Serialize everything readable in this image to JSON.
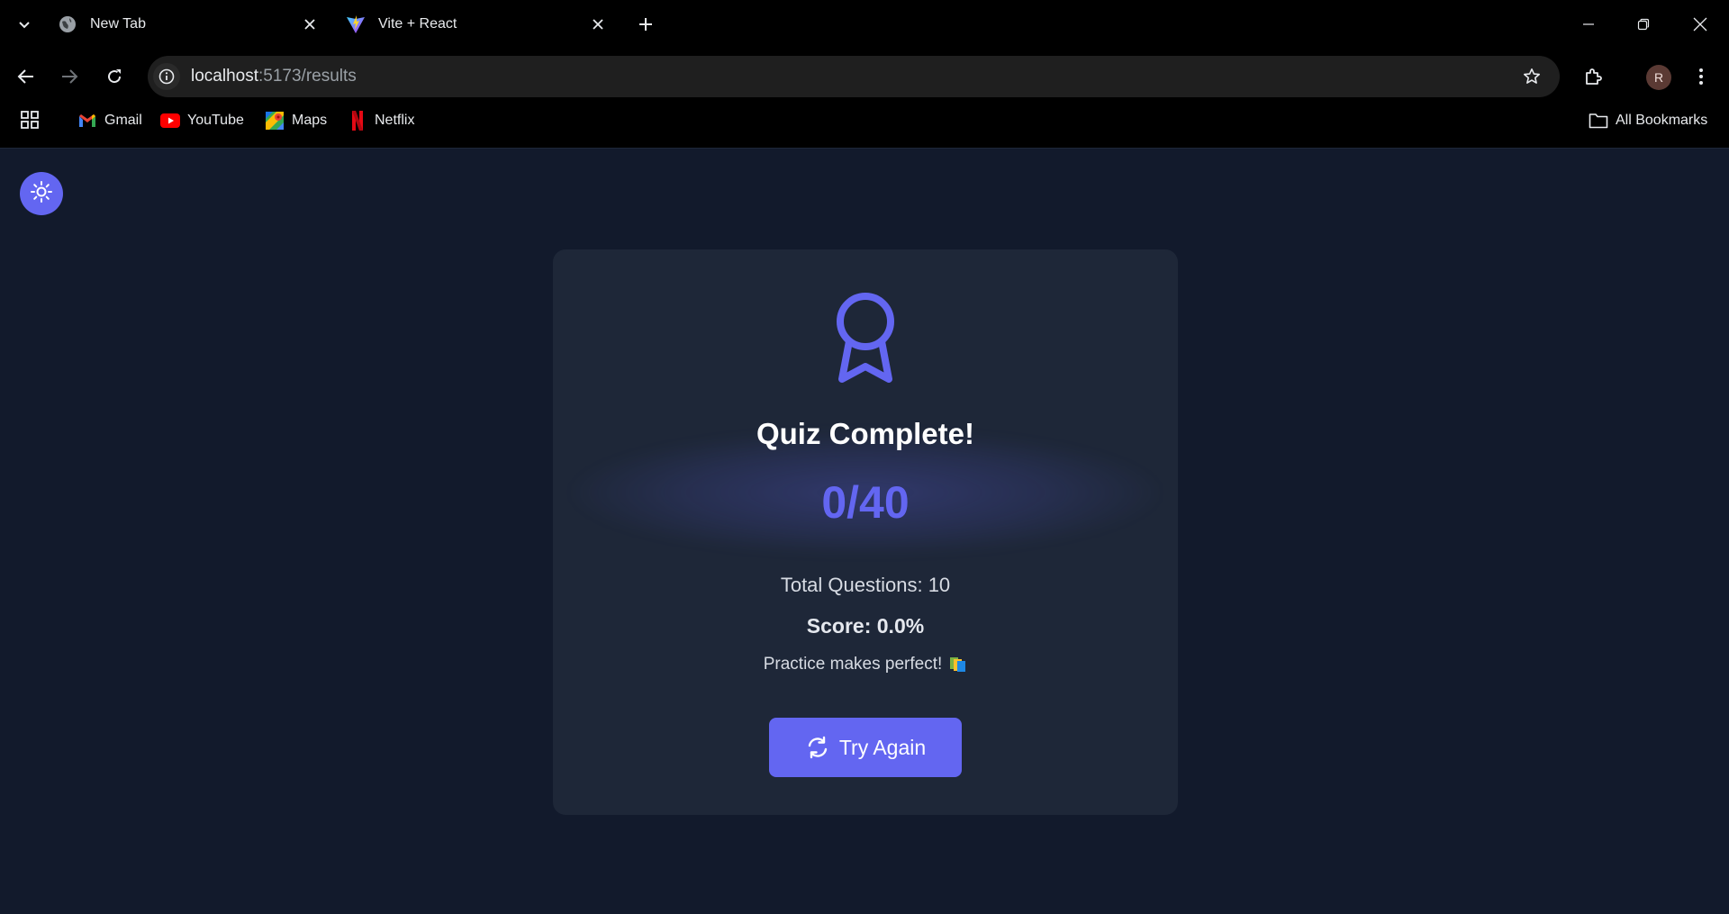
{
  "browser": {
    "tabs": [
      {
        "title": "New Tab",
        "icon": "globe-icon"
      },
      {
        "title": "Vite + React",
        "icon": "vite-icon"
      }
    ],
    "url_host": "localhost",
    "url_rest": ":5173/results",
    "avatar_initial": "R",
    "bookmarks": [
      {
        "label": "Gmail",
        "icon": "gmail-icon"
      },
      {
        "label": "YouTube",
        "icon": "youtube-icon"
      },
      {
        "label": "Maps",
        "icon": "maps-icon"
      },
      {
        "label": "Netflix",
        "icon": "netflix-icon"
      }
    ],
    "all_bookmarks_label": "All Bookmarks"
  },
  "page": {
    "theme_toggle_icon": "sun-icon",
    "result": {
      "icon": "award-icon",
      "title": "Quiz Complete!",
      "score_display": "0/40",
      "total_questions": "Total Questions: 10",
      "score_percent": "Score: 0.0%",
      "message": "Practice makes perfect!",
      "message_icon": "books-emoji",
      "try_again_label": "Try Again",
      "try_again_icon": "refresh-icon"
    }
  },
  "colors": {
    "accent": "#6366f1",
    "page_background": "#121a2c",
    "card_background": "#1e2738"
  }
}
